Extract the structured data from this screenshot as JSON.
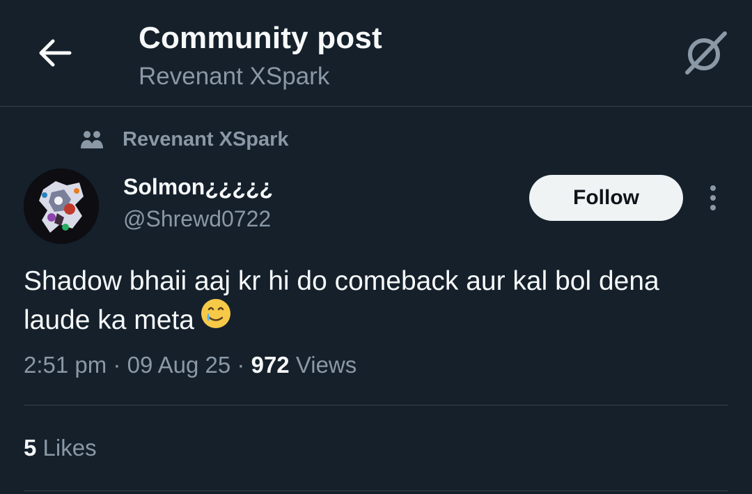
{
  "header": {
    "title": "Community post",
    "subtitle": "Revenant XSpark"
  },
  "community": {
    "name": "Revenant XSpark"
  },
  "author": {
    "display_name": "Solmon¿¿¿¿¿",
    "handle": "@Shrewd0722"
  },
  "follow_label": "Follow",
  "post": {
    "text": "Shadow bhaii aaj kr hi do comeback aur kal bol dena laude ka meta",
    "emoji_icon": "smiling-face-with-tear-icon"
  },
  "meta": {
    "time": "2:51 pm",
    "separator": "·",
    "date": "09 Aug 25",
    "views_count": "972",
    "views_label": "Views"
  },
  "likes": {
    "count": "5",
    "label": "Likes"
  },
  "colors": {
    "background": "#15202b",
    "primary_text": "#f7f9f9",
    "secondary_text": "#8b98a5",
    "divider": "#38444d",
    "button_bg": "#eff3f4"
  }
}
